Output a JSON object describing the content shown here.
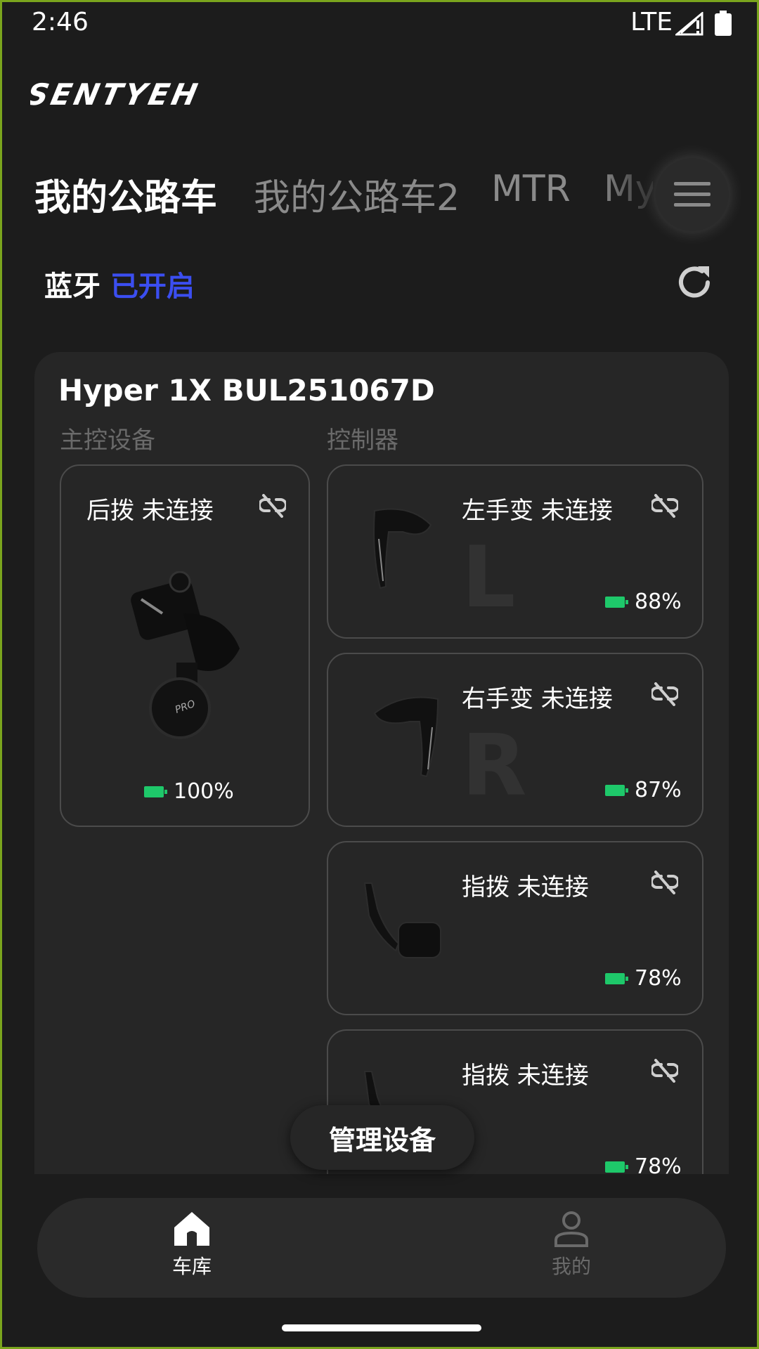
{
  "status_bar": {
    "time": "2:46",
    "network": "LTE"
  },
  "app": {
    "logo_text": "SENTYEH"
  },
  "tabs": [
    {
      "label": "我的公路车",
      "active": true
    },
    {
      "label": "我的公路车2",
      "active": false
    },
    {
      "label": "MTR",
      "active": false
    },
    {
      "label": "My",
      "active": false
    }
  ],
  "bluetooth": {
    "label": "蓝牙",
    "status": "已开启",
    "status_color": "#3b4ef0"
  },
  "device": {
    "title": "Hyper 1X BUL251067D",
    "main_header": "主控设备",
    "controller_header": "控制器",
    "derailleur": {
      "title": "后拨 未连接",
      "battery": "100%"
    },
    "controllers": [
      {
        "title": "左手变 未连接",
        "letter": "L",
        "battery": "88%"
      },
      {
        "title": "右手变 未连接",
        "letter": "R",
        "battery": "87%"
      },
      {
        "title": "指拨 未连接",
        "battery": "78%"
      },
      {
        "title": "指拨 未连接",
        "battery": "78%"
      }
    ]
  },
  "manage_button": "管理设备",
  "nav": {
    "garage": {
      "label": "车库",
      "icon": "home-icon"
    },
    "mine": {
      "label": "我的",
      "icon": "person-icon"
    }
  },
  "colors": {
    "accent": "#3b4ef0",
    "battery": "#1ec86a",
    "background": "#1c1c1c"
  }
}
